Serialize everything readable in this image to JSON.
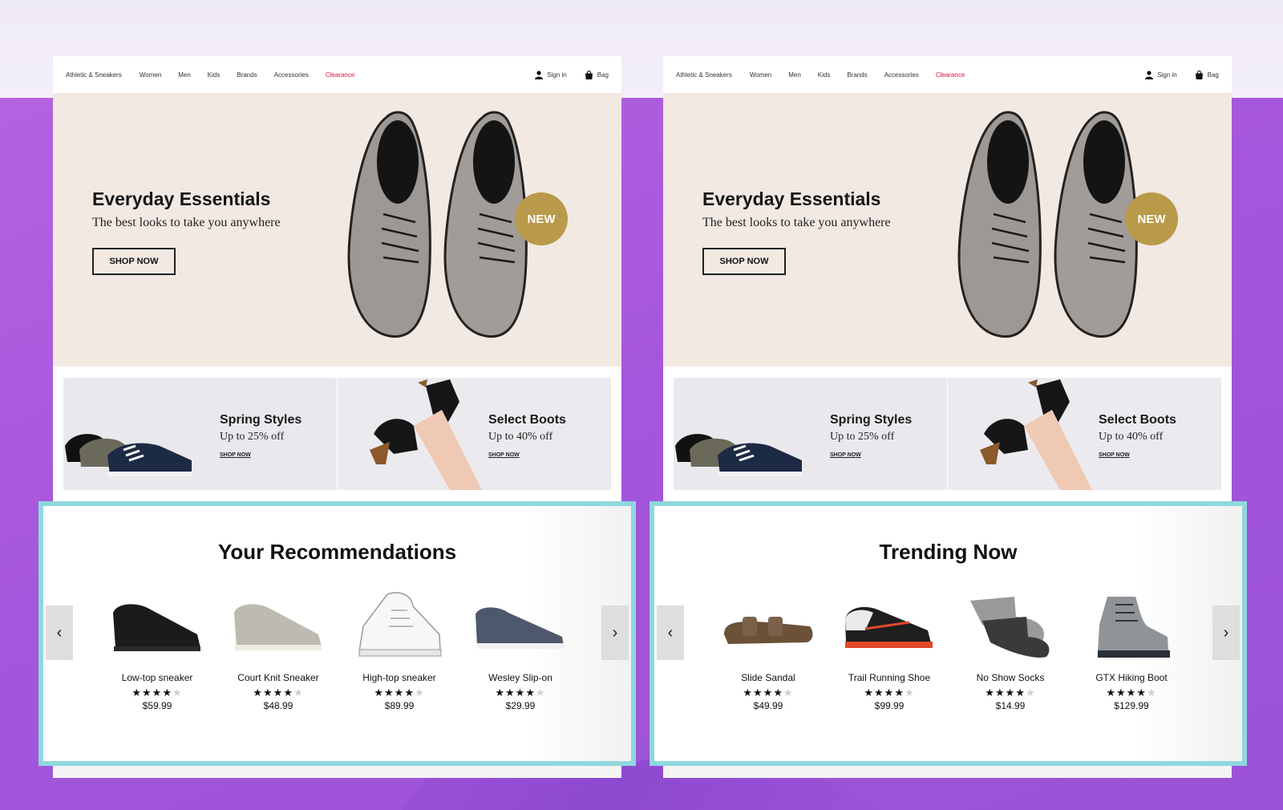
{
  "nav": {
    "brand": "Athletic & Sneakers",
    "links": [
      "Women",
      "Men",
      "Kids",
      "Brands",
      "Accessories",
      "Clearance"
    ],
    "sign_in": "Sign in",
    "bag": "Bag"
  },
  "hero": {
    "title": "Everyday Essentials",
    "subtitle": "The best looks to take you anywhere",
    "cta": "SHOP NOW",
    "badge": "NEW"
  },
  "promos": [
    {
      "title": "Spring Styles",
      "subtitle": "Up to 25% off",
      "link": "SHOP NOW"
    },
    {
      "title": "Select Boots",
      "subtitle": "Up to 40% off",
      "link": "SHOP NOW"
    }
  ],
  "carousels": [
    {
      "title": "Your Recommendations",
      "prev": "‹",
      "next": "›",
      "products": [
        {
          "name": "Low-top sneaker",
          "rating": 4,
          "price": "$59.99",
          "icon": "black-sneaker"
        },
        {
          "name": "Court Knit Sneaker",
          "rating": 4,
          "price": "$48.99",
          "icon": "gray-knit-sneaker"
        },
        {
          "name": "High-top sneaker",
          "rating": 4,
          "price": "$89.99",
          "icon": "white-high-top"
        },
        {
          "name": "Wesley Slip-on",
          "rating": 4,
          "price": "$29.99",
          "icon": "navy-slip-on"
        }
      ]
    },
    {
      "title": "Trending Now",
      "prev": "‹",
      "next": "›",
      "products": [
        {
          "name": "Slide Sandal",
          "rating": 4,
          "price": "$49.99",
          "icon": "brown-sandal"
        },
        {
          "name": "Trail Running Shoe",
          "rating": 4,
          "price": "$99.99",
          "icon": "trail-runner"
        },
        {
          "name": "No Show Socks",
          "rating": 4,
          "price": "$14.99",
          "icon": "gray-socks"
        },
        {
          "name": "GTX Hiking Boot",
          "rating": 4,
          "price": "$129.99",
          "icon": "gray-hiking-boot"
        }
      ]
    }
  ],
  "colors": {
    "accent_clearance": "#d8163c",
    "badge_gold": "#b99a4a",
    "highlight_border": "#8fd7de",
    "background_purple": "#a456dc",
    "hero_bg": "#f2e9e3"
  }
}
